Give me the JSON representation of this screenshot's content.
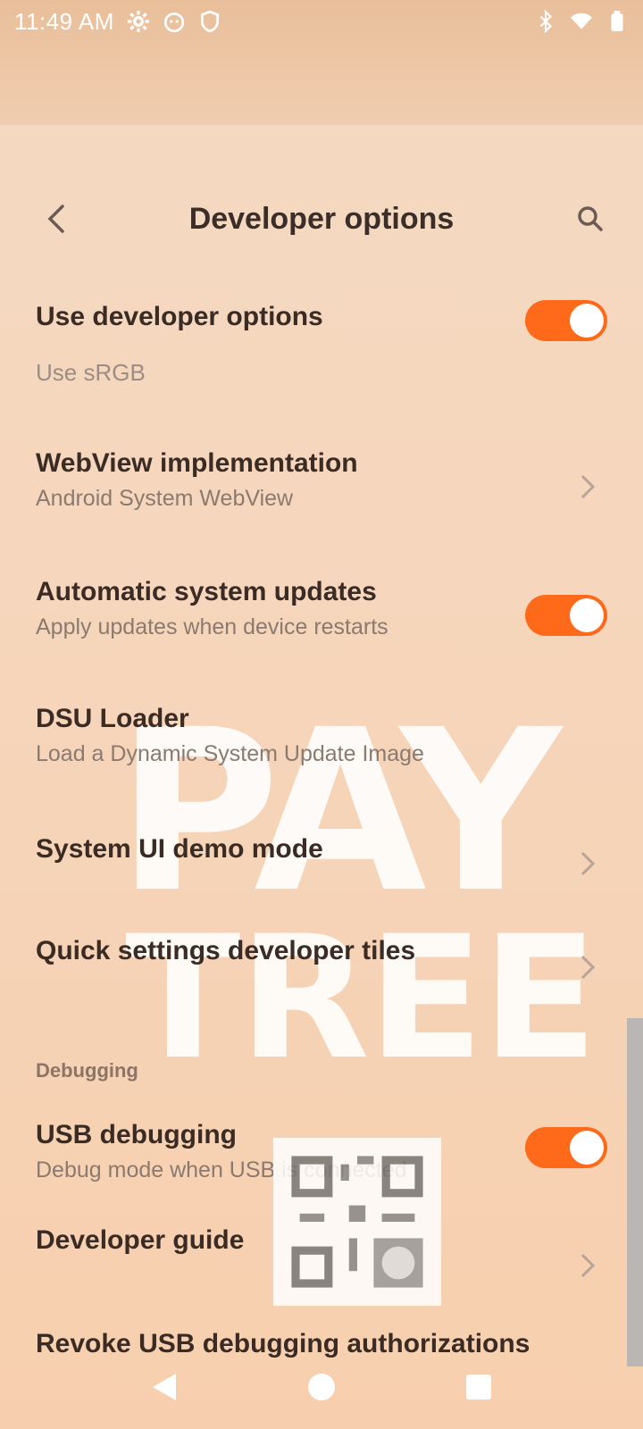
{
  "status_bar": {
    "time": "11:49 AM",
    "left_icons": [
      "gear-icon",
      "cat-icon",
      "shield-icon"
    ],
    "right_icons": [
      "bluetooth-icon",
      "wifi-icon",
      "battery-icon"
    ]
  },
  "header": {
    "title": "Developer options"
  },
  "rows": {
    "use_developer_options": {
      "title": "Use developer options",
      "checked": true
    },
    "use_srgb": {
      "title": "Use sRGB"
    },
    "webview": {
      "title": "WebView implementation",
      "subtitle": "Android System WebView"
    },
    "auto_updates": {
      "title": "Automatic system updates",
      "subtitle": "Apply updates when device restarts",
      "checked": true
    },
    "dsu_loader": {
      "title": "DSU Loader",
      "subtitle": "Load a Dynamic System Update Image"
    },
    "demo_mode": {
      "title": "System UI demo mode"
    },
    "qs_tiles": {
      "title": "Quick settings developer tiles"
    },
    "debugging_header": "Debugging",
    "usb_debugging": {
      "title": "USB debugging",
      "subtitle": "Debug mode when USB is connected",
      "checked": true
    },
    "developer_guide": {
      "title": "Developer guide"
    },
    "revoke_usb": {
      "title": "Revoke USB debugging authorizations"
    }
  },
  "watermark": {
    "line1": "PAY",
    "line2": "TREE"
  },
  "colors": {
    "accent": "#ff6a1a",
    "background": "#f6d6bc"
  }
}
